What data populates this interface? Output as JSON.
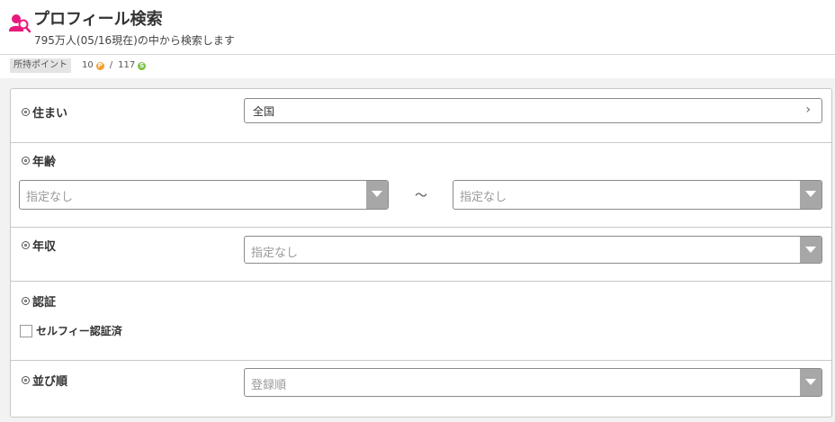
{
  "header": {
    "title": "プロフィール検索",
    "subtitle": "795万人(05/16現在)の中から検索します",
    "icon": "user-search-icon",
    "icon_color": "#e8197d"
  },
  "points": {
    "label": "所持ポイント",
    "paid": "10",
    "separator": "/",
    "service": "117",
    "paid_coin": "P",
    "service_coin": "S"
  },
  "form": {
    "residence": {
      "label": "住まい",
      "value": "全国"
    },
    "age": {
      "label": "年齢",
      "min_value": "指定なし",
      "separator": "～",
      "max_value": "指定なし"
    },
    "income": {
      "label": "年収",
      "value": "指定なし"
    },
    "verification": {
      "label": "認証",
      "option_label": "セルフィー認証済",
      "checked": false
    },
    "sort": {
      "label": "並び順",
      "value": "登録順"
    }
  }
}
